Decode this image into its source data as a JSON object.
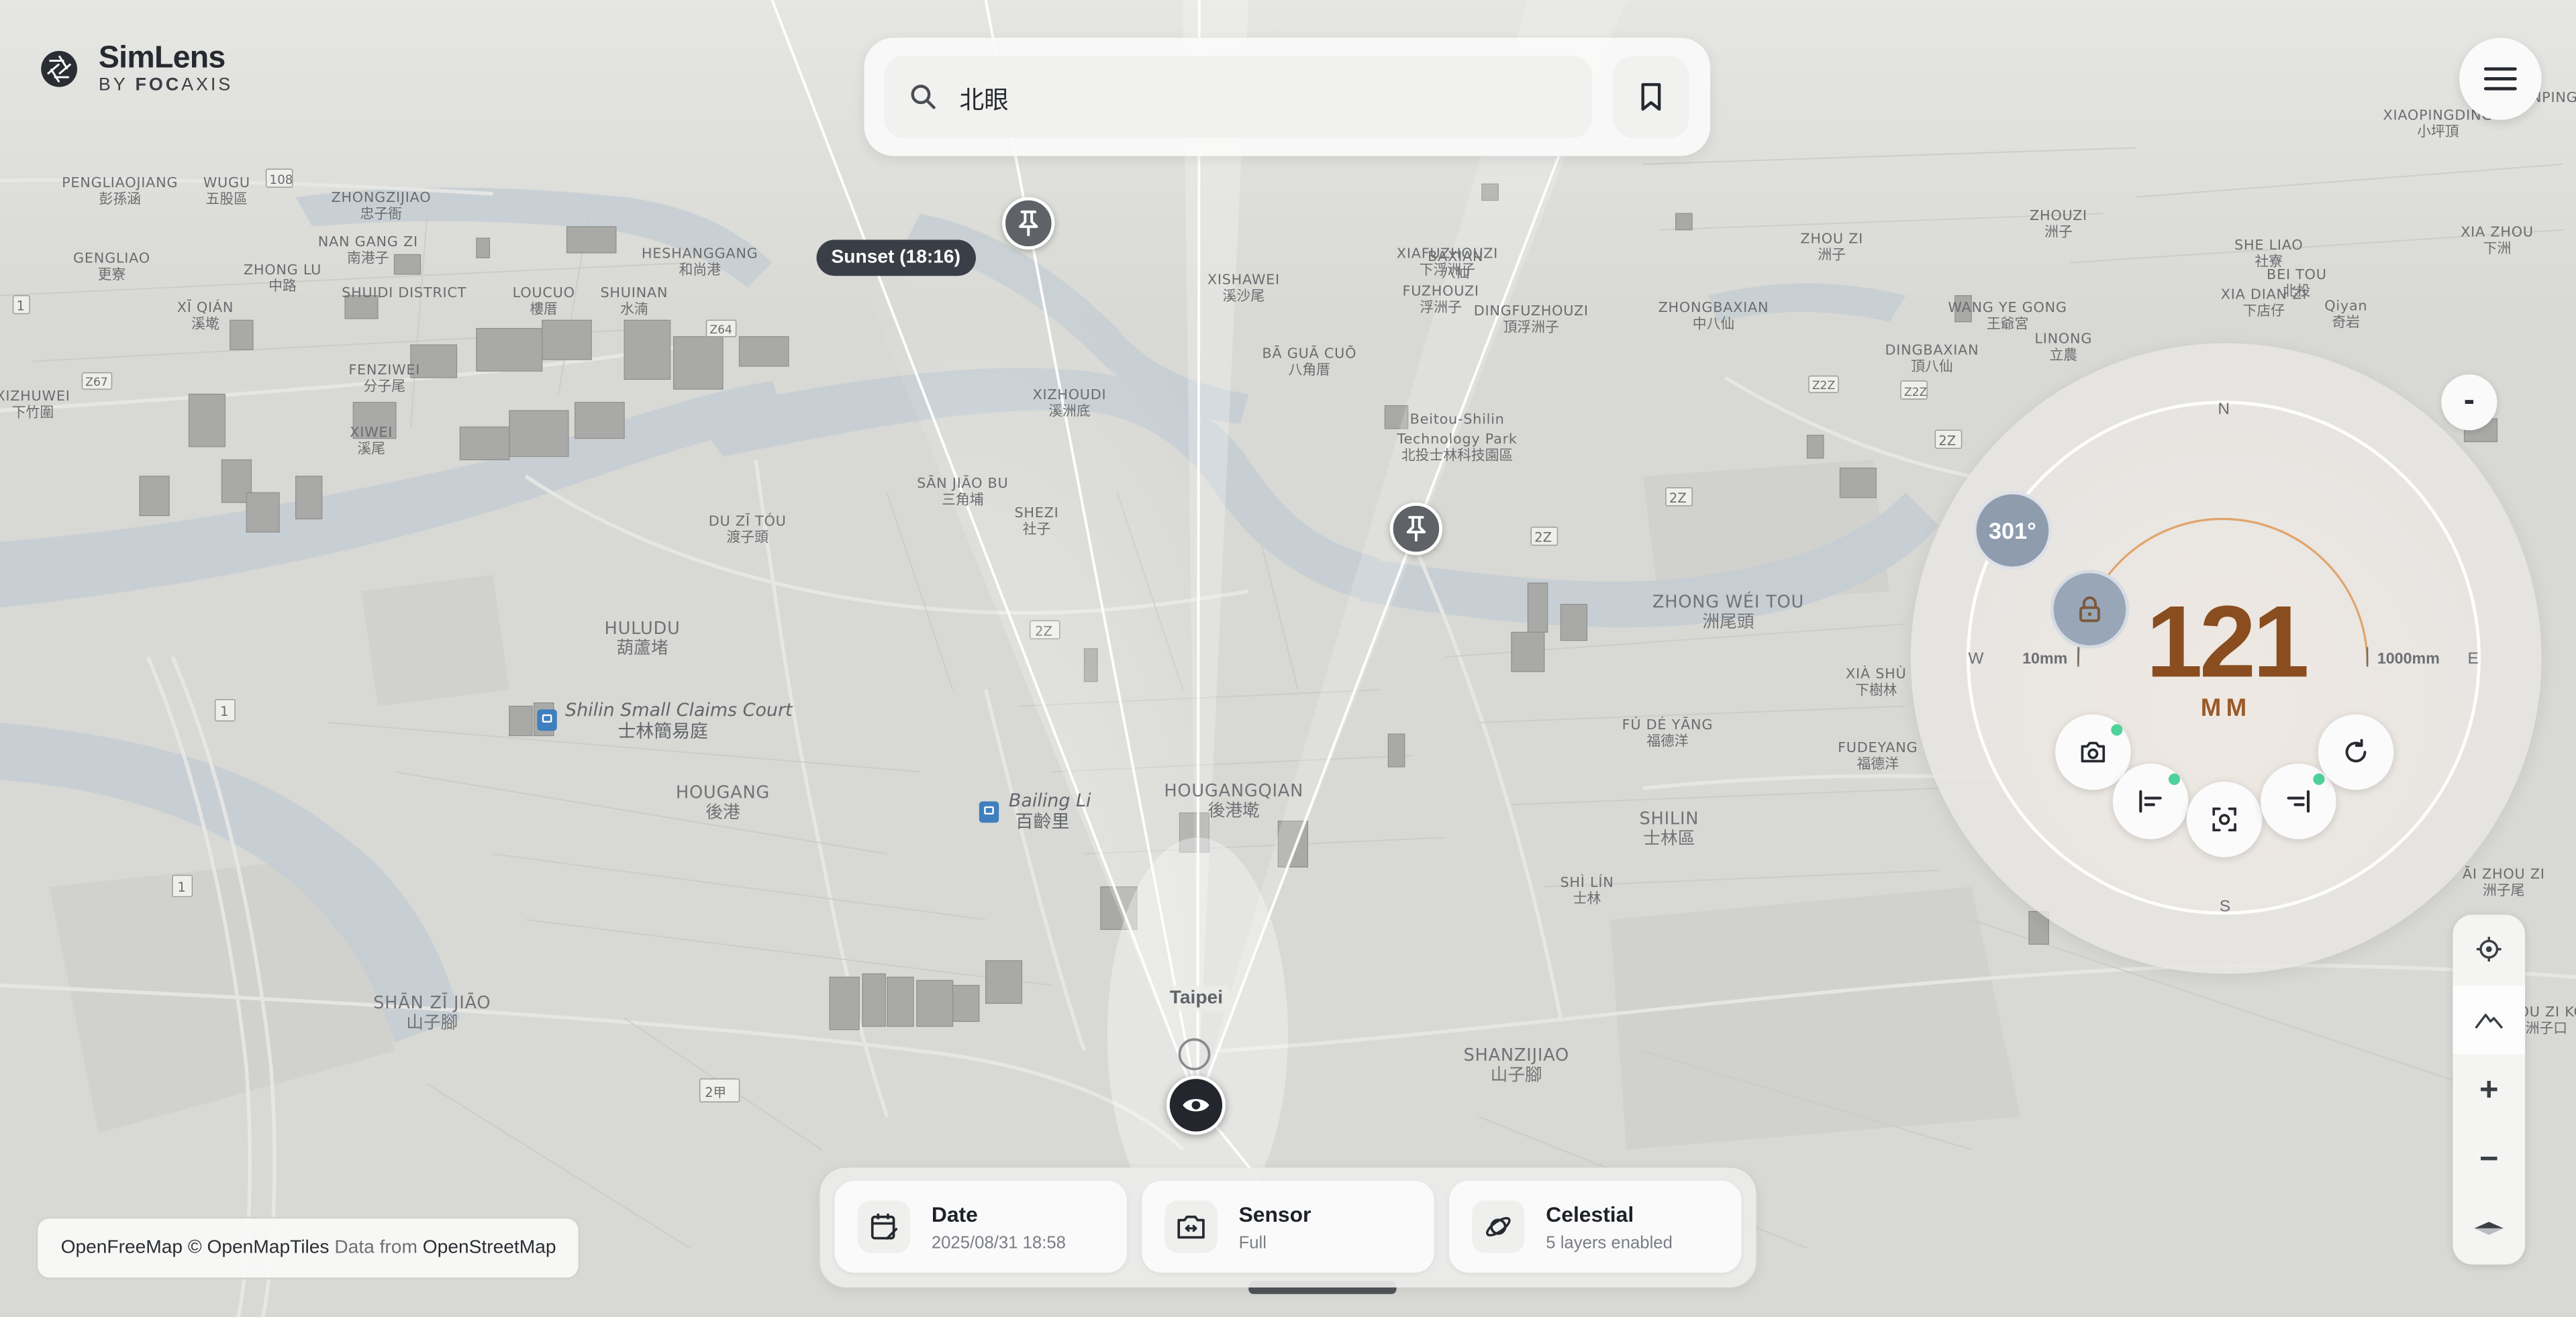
{
  "app": {
    "name": "SimLens",
    "by_prefix": "BY",
    "by_brand_1": "FOC",
    "by_brand_2": "AXIS"
  },
  "search": {
    "value": "北眼",
    "placeholder": ""
  },
  "map": {
    "sunset_tag": "Sunset (18:16)",
    "city_label": "Taipei",
    "labels": [
      {
        "py": "PENGLIAOJIANG",
        "zh": "彭孫涵"
      },
      {
        "py": "WUGU",
        "zh": "五股區"
      },
      {
        "py": "ZHONGZIJIAO",
        "zh": "忠子衙"
      },
      {
        "py": "GENGLIAO",
        "zh": "更寮"
      },
      {
        "py": "NAN GANG ZI",
        "zh": "南港子"
      },
      {
        "py": "ZHONG LU",
        "zh": "中路"
      },
      {
        "py": "HESHANGGANG",
        "zh": "和尚港"
      },
      {
        "py": "XĪ QIÁN",
        "zh": "溪墘"
      },
      {
        "py": "LOUCUO",
        "zh": "樓厝"
      },
      {
        "py": "SHUINAN",
        "zh": "水湳"
      },
      {
        "py": "FENZIWEI",
        "zh": "分子尾"
      },
      {
        "py": "XIZHUWEI",
        "zh": "下竹圍"
      },
      {
        "py": "XIWEI",
        "zh": "溪尾"
      },
      {
        "py": "DU ZĪ TÓU",
        "zh": "渡子頭"
      },
      {
        "py": "HULUDU",
        "zh": "葫蘆堵"
      },
      {
        "py": "HOUGANG",
        "zh": "後港"
      },
      {
        "py": "SHĀN ZĪ JIĀO",
        "zh": "山子腳"
      },
      {
        "py": "SHEZI",
        "zh": "社子"
      },
      {
        "py": "SĀN JIĀO BU",
        "zh": "三角埔"
      },
      {
        "py": "XIZHOUDI",
        "zh": "溪洲底"
      },
      {
        "py": "HOUGANGQIAN",
        "zh": "後港墘"
      },
      {
        "py": "SHANZIJIAO",
        "zh": "山子腳"
      },
      {
        "py": "SHILIN",
        "zh": "士林區"
      },
      {
        "py": "SHÌ LÍN",
        "zh": "士林"
      },
      {
        "py": "FÚ DÉ YĀNG",
        "zh": "福德洋"
      },
      {
        "py": "FUDEYANG",
        "zh": "福德洋"
      },
      {
        "py": "ZHONG WÉI TOU",
        "zh": "洲尾頭"
      },
      {
        "py": "ZHONGBAXIAN",
        "zh": "中八仙"
      },
      {
        "py": "DINGBAXIAN",
        "zh": "頂八仙"
      },
      {
        "py": "WANG YE GONG",
        "zh": "王爺宮"
      },
      {
        "py": "LINONG",
        "zh": "立農"
      },
      {
        "py": "XIA ZHOU",
        "zh": "下洲"
      },
      {
        "py": "SHE LIAO",
        "zh": "社寮"
      },
      {
        "py": "BEI TOU",
        "zh": "北投"
      },
      {
        "py": "Qiyan",
        "zh": "奇岩"
      },
      {
        "py": "XIA DIAN ZI",
        "zh": "下店仔"
      },
      {
        "py": "XIAFUZHOUZI",
        "zh": "下浮洲子"
      },
      {
        "py": "FUZHOUZI",
        "zh": "浮洲子"
      },
      {
        "py": "DINGFUZHOUZI",
        "zh": "頂浮洲子"
      },
      {
        "py": "XISHAWEI",
        "zh": "溪沙尾"
      },
      {
        "py": "BĀ GUĀ CUŌ",
        "zh": "八角厝"
      },
      {
        "py": "XIÀ SHÙ",
        "zh": "下樹林"
      },
      {
        "py": "ZHOUZI",
        "zh": "洲子"
      },
      {
        "py": "ZHOU ZI",
        "zh": "洲子"
      },
      {
        "py": "BAXIAN",
        "zh": "八仙"
      },
      {
        "py": "Beitou-Shilin",
        "zh": ""
      },
      {
        "py": "Technology Park",
        "zh": "北投士林科技園區"
      },
      {
        "py": "ĀI ZHOU ZI",
        "zh": "洲子尾"
      },
      {
        "py": "ZHOU ZI KOU",
        "zh": "洲子口"
      },
      {
        "py": "SHUIDI DISTRICT",
        "zh": ""
      },
      {
        "py": "JINPING",
        "zh": ""
      },
      {
        "py": "XIAOPINGDING",
        "zh": "小坪頂"
      }
    ],
    "pois": [
      {
        "py": "Shilin Small Claims Court",
        "zh": "士林簡易庭"
      },
      {
        "py": "Bailing Li",
        "zh": "百齡里"
      }
    ],
    "roads": [
      "108",
      "1",
      "2Z",
      "1",
      "2甲",
      "Z64",
      "Z67",
      "Z2Z",
      "2Z",
      "2Z",
      "2Z"
    ]
  },
  "dial": {
    "heading": "301°",
    "focal_length": "121",
    "unit": "MM",
    "min_label": "10mm",
    "max_label": "1000mm",
    "compass": {
      "n": "N",
      "s": "S",
      "e": "E",
      "w": "W"
    },
    "collapse_label": "-",
    "buttons": [
      {
        "name": "camera",
        "has_dot": true
      },
      {
        "name": "align-left",
        "has_dot": true
      },
      {
        "name": "capture",
        "has_dot": false
      },
      {
        "name": "align-right",
        "has_dot": true
      },
      {
        "name": "reset",
        "has_dot": false
      }
    ]
  },
  "controls": {
    "zoom_in": "+",
    "zoom_out": "−"
  },
  "bottom": {
    "date": {
      "title": "Date",
      "subtitle": "2025/08/31 18:58"
    },
    "sensor": {
      "title": "Sensor",
      "subtitle": "Full"
    },
    "celestial": {
      "title": "Celestial",
      "subtitle": "5 layers enabled"
    }
  },
  "attribution": {
    "part1": "OpenFreeMap",
    "part2": "© OpenMapTiles",
    "part3": "Data from",
    "part4": "OpenStreetMap"
  },
  "colors": {
    "accent_focal": "#8a4d1f",
    "arc": "#e0a46a",
    "status_dot": "#4fd29a",
    "heading_badge": "#8e9cae"
  }
}
